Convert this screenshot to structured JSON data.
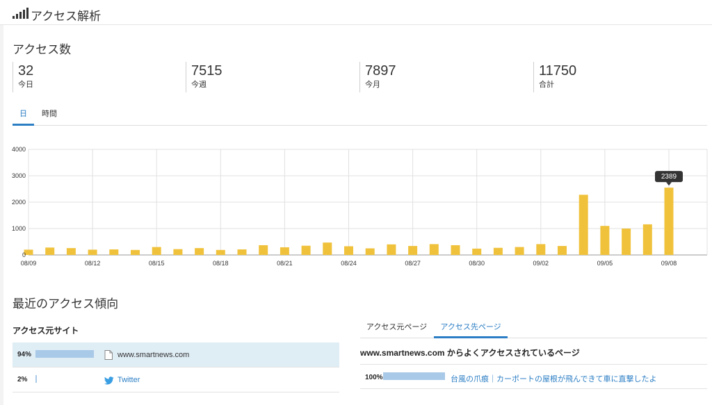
{
  "header": {
    "title": "アクセス解析",
    "icon": "signal-bars-icon"
  },
  "access_count": {
    "title": "アクセス数",
    "stats": [
      {
        "value": "32",
        "label": "今日"
      },
      {
        "value": "7515",
        "label": "今週"
      },
      {
        "value": "7897",
        "label": "今月"
      },
      {
        "value": "11750",
        "label": "合計"
      }
    ]
  },
  "range_tabs": {
    "day": "日",
    "hour": "時間",
    "active": "日"
  },
  "chart_data": {
    "type": "bar",
    "categories": [
      "08/09",
      "08/10",
      "08/11",
      "08/12",
      "08/13",
      "08/14",
      "08/15",
      "08/16",
      "08/17",
      "08/18",
      "08/19",
      "08/20",
      "08/21",
      "08/22",
      "08/23",
      "08/24",
      "08/25",
      "08/26",
      "08/27",
      "08/28",
      "08/29",
      "08/30",
      "08/31",
      "09/01",
      "09/02",
      "09/03",
      "09/04",
      "09/05",
      "09/06",
      "09/07",
      "09/08"
    ],
    "tick_labels": [
      "08/09",
      "08/12",
      "08/15",
      "08/18",
      "08/21",
      "08/24",
      "08/27",
      "08/30",
      "09/02",
      "09/05",
      "09/08"
    ],
    "values": [
      200,
      280,
      260,
      200,
      210,
      190,
      300,
      220,
      260,
      190,
      210,
      370,
      290,
      350,
      470,
      330,
      250,
      400,
      340,
      410,
      370,
      240,
      270,
      300,
      410,
      340,
      2280,
      1100,
      1000,
      1160,
      2550
    ],
    "ylim": [
      0,
      4000
    ],
    "yticks": [
      0,
      1000,
      2000,
      3000,
      4000
    ],
    "tooltip": {
      "category": "09/08",
      "value": "2389"
    },
    "color": "#f0c23c",
    "grid": true
  },
  "trends": {
    "title": "最近のアクセス傾向"
  },
  "sources": {
    "title": "アクセス元サイト",
    "rows": [
      {
        "pct": "94%",
        "share": 94,
        "name": "www.smartnews.com",
        "icon": "page-icon"
      },
      {
        "pct": "2%",
        "share": 2,
        "name": "Twitter",
        "icon": "twitter-bird-icon"
      }
    ]
  },
  "page_tabs": {
    "source": "アクセス元ページ",
    "dest": "アクセス先ページ",
    "active": "アクセス先ページ"
  },
  "dest": {
    "title": "www.smartnews.com からよくアクセスされているページ",
    "rows": [
      {
        "pct": "100%",
        "share": 100,
        "name": "台風の爪痕｜カーポートの屋根が飛んできて車に直撃したよ"
      }
    ]
  }
}
